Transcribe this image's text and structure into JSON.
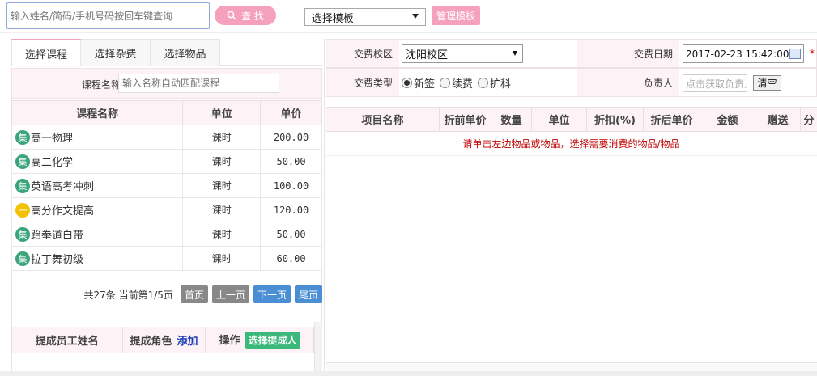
{
  "topbar": {
    "search_placeholder": "输入姓名/简码/手机号码按回车键查询",
    "search_button": "查 找",
    "template_select": "-选择模板-",
    "manage_button": "管理模板"
  },
  "left": {
    "tabs": [
      "选择课程",
      "选择杂费",
      "选择物品"
    ],
    "course_filter_label": "课程名称",
    "course_filter_placeholder": "输入名称自动匹配课程",
    "course_table": {
      "headers": [
        "课程名称",
        "单位",
        "单价"
      ],
      "rows": [
        {
          "badge": "集",
          "badge_color": "#3aa57a",
          "name": "高一物理",
          "unit": "课时",
          "price": "200.00"
        },
        {
          "badge": "集",
          "badge_color": "#3aa57a",
          "name": "高二化学",
          "unit": "课时",
          "price": "50.00"
        },
        {
          "badge": "集",
          "badge_color": "#3aa57a",
          "name": "英语高考冲刺",
          "unit": "课时",
          "price": "100.00"
        },
        {
          "badge": "一",
          "badge_color": "#f2c200",
          "name": "高分作文提高",
          "unit": "课时",
          "price": "120.00"
        },
        {
          "badge": "集",
          "badge_color": "#3aa57a",
          "name": "跆拳道白带",
          "unit": "课时",
          "price": "50.00"
        },
        {
          "badge": "集",
          "badge_color": "#3aa57a",
          "name": "拉丁舞初级",
          "unit": "课时",
          "price": "60.00"
        }
      ]
    },
    "pager": {
      "info": "共27条  当前第1/5页",
      "first": "首页",
      "prev": "上一页",
      "next": "下一页",
      "last": "尾页"
    },
    "staff_table": {
      "col_name": "提成员工姓名",
      "col_role": "提成角色",
      "add_link": "添加",
      "col_op": "操作",
      "select_button": "选择提成人"
    }
  },
  "right": {
    "campus_label": "交费校区",
    "campus_value": "沈阳校区",
    "date_label": "交费日期",
    "date_value": "2017-02-23 15:42:00",
    "required_mark": "*",
    "type_label": "交费类型",
    "type_options": [
      "新签",
      "续费",
      "扩科"
    ],
    "type_selected": "新签",
    "owner_label": "负责人",
    "owner_placeholder": "点击获取负责人",
    "clear_button": "清空",
    "item_table_headers": [
      "项目名称",
      "折前单价",
      "数量",
      "单位",
      "折扣(%)",
      "折后单价",
      "金额",
      "赠送",
      "分"
    ],
    "empty_message": "请单击左边物品或物品，选择需要消费的物品/物品"
  }
}
